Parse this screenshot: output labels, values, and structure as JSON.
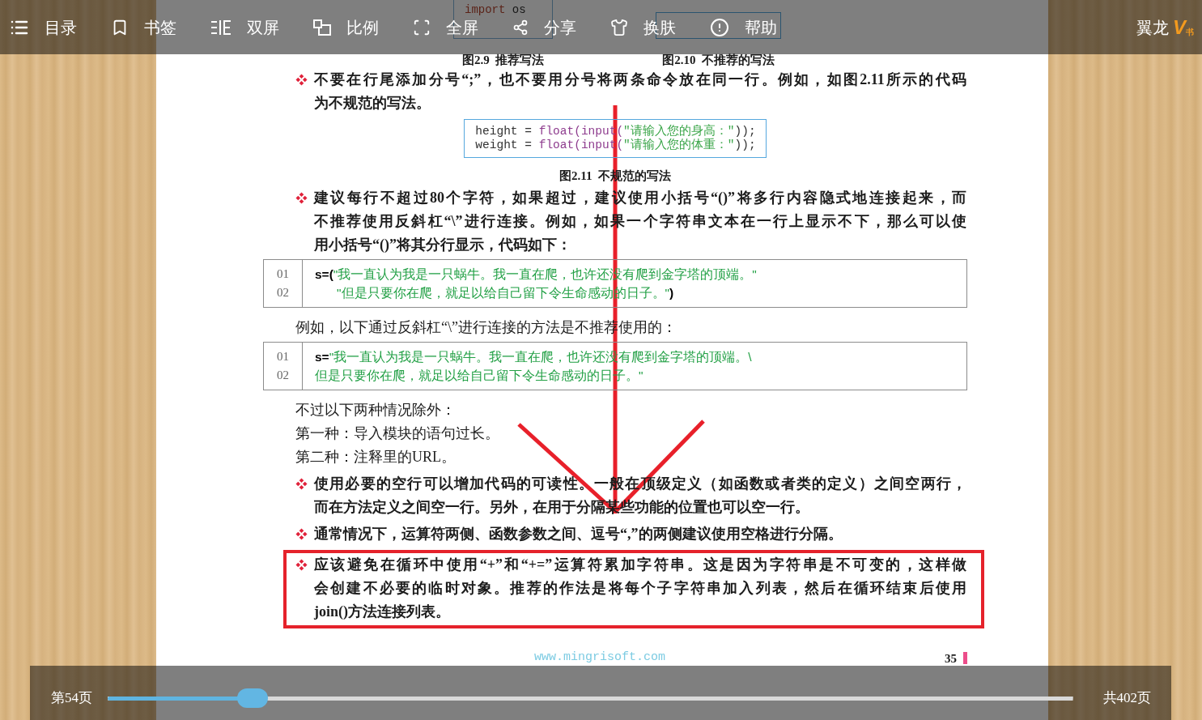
{
  "toolbar": {
    "items": [
      {
        "label": "目录"
      },
      {
        "label": "书签"
      },
      {
        "label": "双屏"
      },
      {
        "label": "比例"
      },
      {
        "label": "全屏"
      },
      {
        "label": "分享"
      },
      {
        "label": "换肤"
      },
      {
        "label": "帮助"
      }
    ],
    "brand": {
      "name": "翼龙",
      "logo_mark": "V",
      "logo_sub": "书"
    }
  },
  "page": {
    "figures": [
      {
        "code_lines": [
          [
            {
              "kind": "keyword",
              "text": "import"
            },
            {
              "kind": "plain",
              "text": " os"
            }
          ]
        ],
        "caption": "图2.9  推荐写法"
      },
      {
        "caption": "图2.10  不推荐的写法"
      }
    ],
    "blocks": [
      {
        "kind": "bullet",
        "lines": [
          "不要在行尾添加分号“;”，也不要用分号将两条命令放在同一行。例如，如图2.11所示的代码",
          "为不规范的写法。"
        ],
        "highlighted": false
      },
      {
        "kind": "code_figure",
        "lines": [
          {
            "segments": [
              {
                "kind": "plain",
                "text": "height = "
              },
              {
                "kind": "function",
                "text": "float(input("
              },
              {
                "kind": "string",
                "text": "\"请输入您的身高：\""
              },
              {
                "kind": "plain",
                "text": "));"
              }
            ]
          },
          {
            "segments": [
              {
                "kind": "plain",
                "text": "weight = "
              },
              {
                "kind": "function",
                "text": "float(input("
              },
              {
                "kind": "string",
                "text": "\"请输入您的体重：\""
              },
              {
                "kind": "plain",
                "text": "));"
              }
            ]
          }
        ]
      },
      {
        "kind": "caption",
        "text": "图2.11  不规范的写法"
      },
      {
        "kind": "bullet",
        "lines": [
          "建议每行不超过80个字符，如果超过，建议使用小括号“()”将多行内容隐式地连接起来，而",
          "不推荐使用反斜杠“\\”进行连接。例如，如果一个字符串文本在一行上显示不下，那么可以使",
          "用小括号“()”将其分行显示，代码如下："
        ],
        "highlighted": false
      },
      {
        "kind": "code_listing",
        "lines": [
          {
            "number": "01",
            "indent": false,
            "segments": [
              {
                "kind": "plain",
                "text": "s=("
              },
              {
                "kind": "string",
                "text": "\"我一直认为我是一只蜗牛。我一直在爬，也许还没有爬到金字塔的顶端。\""
              }
            ]
          },
          {
            "number": "02",
            "indent": true,
            "segments": [
              {
                "kind": "string",
                "text": "\"但是只要你在爬，就足以给自己留下令生命感动的日子。\""
              },
              {
                "kind": "plain",
                "text": ")"
              }
            ]
          }
        ]
      },
      {
        "kind": "paragraph",
        "text": "例如，以下通过反斜杠“\\”进行连接的方法是不推荐使用的："
      },
      {
        "kind": "code_listing",
        "lines": [
          {
            "number": "01",
            "indent": false,
            "segments": [
              {
                "kind": "plain",
                "text": "s="
              },
              {
                "kind": "string",
                "text": "\"我一直认为我是一只蜗牛。我一直在爬，也许还没有爬到金字塔的顶端。\\"
              }
            ]
          },
          {
            "number": "02",
            "indent": false,
            "segments": [
              {
                "kind": "string",
                "text": "但是只要你在爬，就足以给自己留下令生命感动的日子。\""
              }
            ]
          }
        ]
      },
      {
        "kind": "paragraph",
        "text": "不过以下两种情况除外："
      },
      {
        "kind": "paragraph",
        "text": "第一种：导入模块的语句过长。"
      },
      {
        "kind": "paragraph",
        "text": "第二种：注释里的URL。"
      },
      {
        "kind": "bullet",
        "lines": [
          "使用必要的空行可以增加代码的可读性。一般在顶级定义（如函数或者类的定义）之间空两行，",
          "而在方法定义之间空一行。另外，在用于分隔某些功能的位置也可以空一行。"
        ],
        "highlighted": false
      },
      {
        "kind": "bullet",
        "lines": [
          "通常情况下，运算符两侧、函数参数之间、逗号“,”的两侧建议使用空格进行分隔。"
        ],
        "highlighted": false
      },
      {
        "kind": "bullet",
        "lines": [
          "应该避免在循环中使用“+”和“+=”运算符累加字符串。这是因为字符串是不可变的，这样做",
          "会创建不必要的临时对象。推荐的作法是将每个子字符串加入列表，然后在循环结束后使用",
          "join()方法连接列表。"
        ],
        "highlighted": true
      }
    ],
    "footer": {
      "url": "www.mingrisoft.com",
      "page_number": "35"
    }
  },
  "bottom_bar": {
    "current_page": "第54页",
    "slider": {
      "level": 0.15
    },
    "total_pages": "共402页"
  }
}
